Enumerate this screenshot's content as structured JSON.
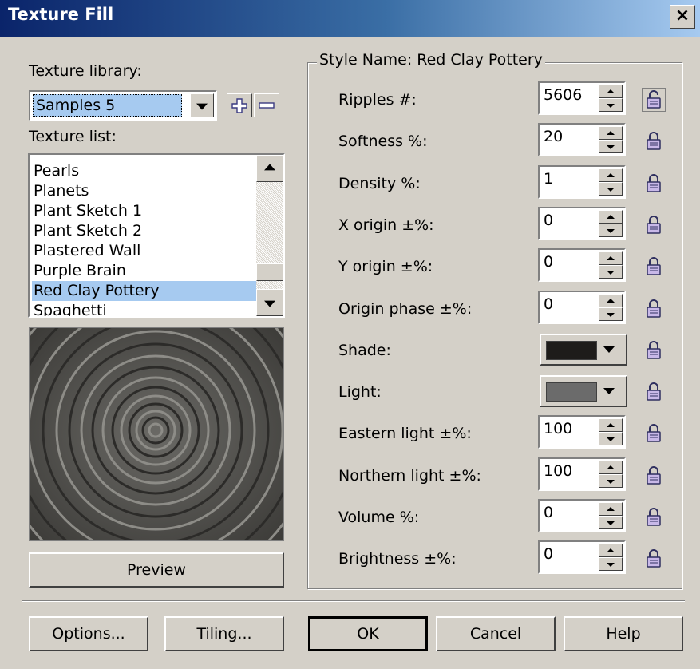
{
  "window": {
    "title": "Texture Fill",
    "close_label": "×"
  },
  "library": {
    "label": "Texture library:",
    "selected": "Samples 5"
  },
  "texture_list": {
    "label": "Texture list:",
    "items": [
      "Pearls",
      "Planets",
      "Plant Sketch 1",
      "Plant Sketch 2",
      "Plastered Wall",
      "Purple Brain",
      "Red Clay Pottery",
      "Spaghetti"
    ],
    "selected_index": 6
  },
  "style_group": {
    "title": "Style Name: Red Clay Pottery"
  },
  "params": [
    {
      "label": "Ripples #:",
      "value": "5606",
      "type": "spin",
      "locked": false
    },
    {
      "label": "Softness %:",
      "value": "20",
      "type": "spin",
      "locked": true
    },
    {
      "label": "Density %:",
      "value": "1",
      "type": "spin",
      "locked": true
    },
    {
      "label": "X origin ±%:",
      "value": "0",
      "type": "spin",
      "locked": true
    },
    {
      "label": "Y origin ±%:",
      "value": "0",
      "type": "spin",
      "locked": true
    },
    {
      "label": "Origin phase ±%:",
      "value": "0",
      "type": "spin",
      "locked": true
    },
    {
      "label": "Shade:",
      "type": "color",
      "color": "#1e1c1a",
      "locked": true
    },
    {
      "label": "Light:",
      "type": "color",
      "color": "#6b6b6b",
      "locked": true
    },
    {
      "label": "Eastern light ±%:",
      "value": "100",
      "type": "spin",
      "locked": true
    },
    {
      "label": "Northern light ±%:",
      "value": "100",
      "type": "spin",
      "locked": true
    },
    {
      "label": "Volume %:",
      "value": "0",
      "type": "spin",
      "locked": true
    },
    {
      "label": "Brightness ±%:",
      "value": "0",
      "type": "spin",
      "locked": true
    }
  ],
  "buttons": {
    "preview": "Preview",
    "options": "Options...",
    "tiling": "Tiling...",
    "ok": "OK",
    "cancel": "Cancel",
    "help": "Help"
  },
  "icons": {
    "add": "plus-icon",
    "remove": "minus-icon",
    "lock": "lock-icon"
  },
  "colors": {
    "titlebar": "#0a246a",
    "selection": "#a6caf0",
    "dialog": "#d4d0c8"
  }
}
